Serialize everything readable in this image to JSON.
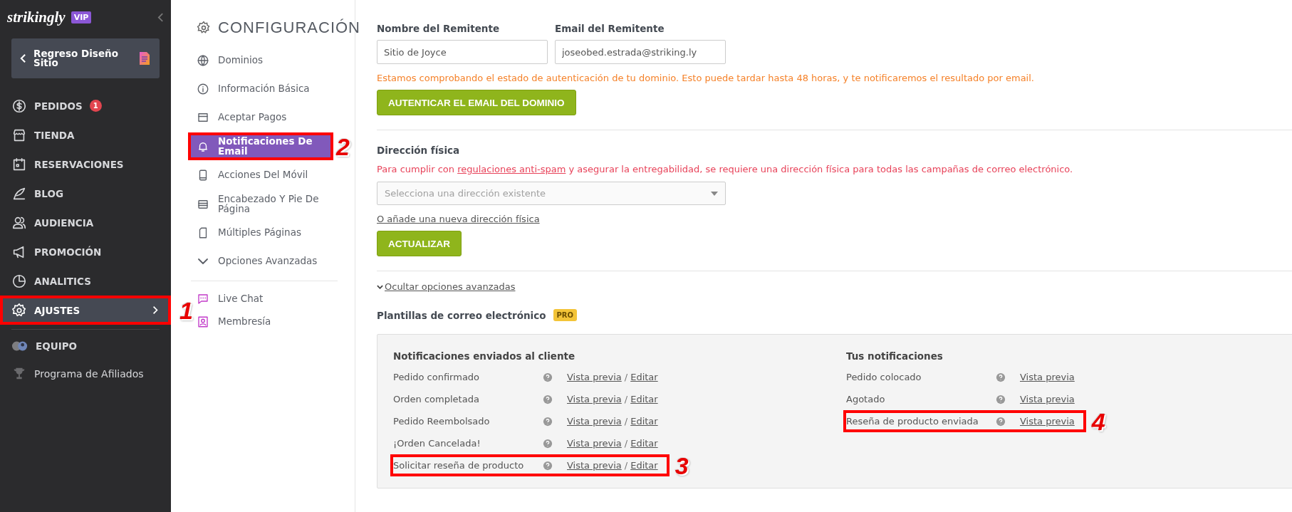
{
  "sidebar": {
    "logo": "strikingly",
    "plan_badge": "VIP",
    "back_button": "Regreso Diseño Sitio",
    "items": [
      {
        "label": "PEDIDOS",
        "badge": "1",
        "selected": false
      },
      {
        "label": "TIENDA",
        "selected": false
      },
      {
        "label": "RESERVACIONES",
        "selected": false
      },
      {
        "label": "BLOG",
        "selected": false
      },
      {
        "label": "AUDIENCIA",
        "selected": false
      },
      {
        "label": "PROMOCIÓN",
        "selected": false
      },
      {
        "label": "ANALITICS",
        "selected": false
      },
      {
        "label": "AJUSTES",
        "selected": true,
        "callout": "1"
      }
    ],
    "footer_items": [
      {
        "label": "EQUIPO"
      },
      {
        "label": "Programa de Afiliados"
      }
    ]
  },
  "settings_nav": {
    "title": "CONFIGURACIÓN",
    "items": [
      {
        "label": "Dominios",
        "selected": false
      },
      {
        "label": "Información Básica",
        "selected": false
      },
      {
        "label": "Aceptar Pagos",
        "selected": false
      },
      {
        "label": "Notificaciones De Email",
        "selected": true,
        "callout": "2"
      },
      {
        "label": "Acciones Del Móvil",
        "selected": false
      },
      {
        "label": "Encabezado Y Pie De Página",
        "selected": false
      },
      {
        "label": "Múltiples Páginas",
        "selected": false
      },
      {
        "label": "Opciones Avanzadas",
        "selected": false
      }
    ],
    "extra_items": [
      {
        "label": "Live Chat"
      },
      {
        "label": "Membresía"
      }
    ]
  },
  "sender": {
    "name_label": "Nombre del Remitente",
    "name_value": "Sitio de Joyce",
    "email_label": "Email del Remitente",
    "email_value": "joseobed.estrada@striking.ly",
    "notice": "Estamos comprobando el estado de autenticación de tu dominio. Esto puede tardar hasta 48 horas, y te notificaremos el resultado por email.",
    "button": "AUTENTICAR EL EMAIL DEL DOMINIO"
  },
  "address": {
    "label": "Dirección física",
    "warning_before": "Para cumplir con ",
    "warning_link": "regulaciones anti-spam",
    "warning_after": " y asegurar la entregabilidad, se requiere una dirección física para todas las campañas de correo electrónico.",
    "select_placeholder": "Selecciona una dirección existente",
    "add_link": "O añade una nueva dirección física",
    "button": "ACTUALIZAR"
  },
  "advanced_toggle": "Ocultar opciones avanzadas",
  "templates": {
    "title": "Plantillas de correo electrónico",
    "badge": "PRO",
    "link_separator": "/",
    "columns": [
      {
        "heading": "Notificaciones enviados al cliente",
        "rows": [
          {
            "name": "Pedido confirmado",
            "links": [
              "Vista previa",
              "Editar"
            ]
          },
          {
            "name": "Orden completada",
            "links": [
              "Vista previa",
              "Editar"
            ]
          },
          {
            "name": "Pedido Reembolsado",
            "links": [
              "Vista previa",
              "Editar"
            ]
          },
          {
            "name": "¡Orden Cancelada!",
            "links": [
              "Vista previa",
              "Editar"
            ]
          },
          {
            "name": "Solicitar reseña de producto",
            "links": [
              "Vista previa",
              "Editar"
            ],
            "callout": "3"
          }
        ]
      },
      {
        "heading": "Tus notificaciones",
        "rows": [
          {
            "name": "Pedido colocado",
            "links": [
              "Vista previa"
            ]
          },
          {
            "name": "Agotado",
            "links": [
              "Vista previa"
            ]
          },
          {
            "name": "Reseña de producto enviada",
            "links": [
              "Vista previa"
            ],
            "callout": "4"
          }
        ]
      }
    ]
  }
}
